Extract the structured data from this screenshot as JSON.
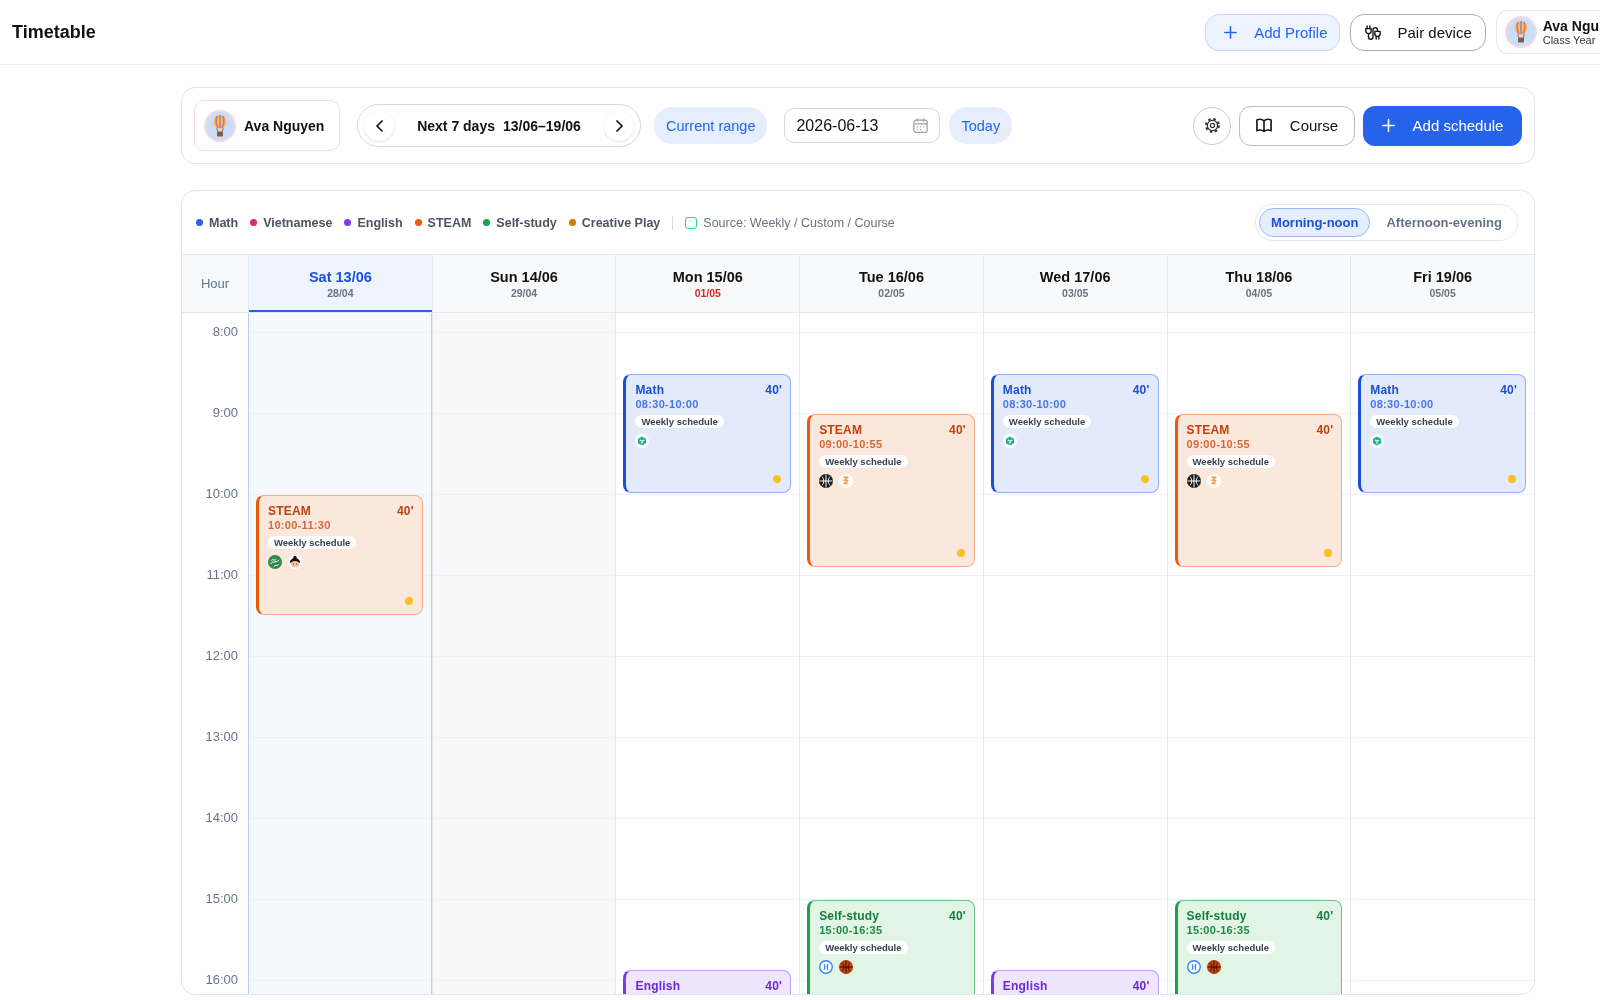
{
  "header": {
    "title": "Timetable",
    "add_profile": "Add Profile",
    "pair_device": "Pair device",
    "profile": {
      "name": "Ava Ngu",
      "subtitle": "Class Year"
    }
  },
  "toolbar": {
    "profile_name": "Ava Nguyen",
    "range_label": "Next 7 days",
    "range_dates": "13/06–19/06",
    "current_range": "Current range",
    "date_value": "2026-06-13",
    "today": "Today",
    "course": "Course",
    "add_schedule": "Add schedule"
  },
  "legend": {
    "items": [
      {
        "label": "Math",
        "color": "#2563eb"
      },
      {
        "label": "Vietnamese",
        "color": "#db2777"
      },
      {
        "label": "English",
        "color": "#7c3aed"
      },
      {
        "label": "STEAM",
        "color": "#ea580c"
      },
      {
        "label": "Self-study",
        "color": "#16a34a"
      },
      {
        "label": "Creative Play",
        "color": "#d97706"
      }
    ],
    "source": "Source: Weekly / Custom / Course"
  },
  "period_toggle": [
    {
      "label": "Morning-noon",
      "selected": true
    },
    {
      "label": "Afternoon-evening",
      "selected": false
    }
  ],
  "grid": {
    "hour_header": "Hour",
    "hours": [
      "8:00",
      "9:00",
      "10:00",
      "11:00",
      "12:00",
      "13:00",
      "14:00",
      "15:00",
      "16:00"
    ],
    "days": [
      {
        "label": "Sat 13/06",
        "lunar": "28/04",
        "selected": true,
        "shaded": false,
        "marked": false,
        "events": [
          {
            "kind": "steam",
            "title": "STEAM",
            "duration": "40'",
            "time": "10:00-11:30",
            "badge": "Weekly schedule",
            "icons": [
              {
                "kind": "swirl"
              },
              {
                "kind": "kid"
              }
            ],
            "color": "#fbbf24"
          }
        ]
      },
      {
        "label": "Sun 14/06",
        "lunar": "29/04",
        "selected": false,
        "shaded": true,
        "marked": false
      },
      {
        "label": "Mon 15/06",
        "lunar": "01/05",
        "selected": false,
        "shaded": false,
        "marked": true,
        "events": [
          {
            "kind": "math",
            "title": "Math",
            "duration": "40'",
            "time": "08:30-10:00",
            "badge": "Weekly schedule",
            "icons": [
              {
                "kind": "cube"
              }
            ],
            "color": "#fbbf24"
          },
          {
            "kind": "english",
            "title": "English",
            "duration": "40'"
          }
        ]
      },
      {
        "label": "Tue 16/06",
        "lunar": "02/05",
        "selected": false,
        "shaded": false,
        "marked": false,
        "events": [
          {
            "kind": "steam",
            "title": "STEAM",
            "duration": "40'",
            "time": "09:00-10:55",
            "badge": "Weekly schedule",
            "icons": [
              {
                "kind": "cross"
              },
              {
                "kind": "squiggle"
              }
            ],
            "color": "#fbbf24"
          },
          {
            "kind": "study",
            "title": "Self-study",
            "duration": "40'",
            "time": "15:00-16:35",
            "badge": "Weekly schedule",
            "icons": [
              {
                "kind": "pause"
              },
              {
                "kind": "ball"
              }
            ]
          }
        ]
      },
      {
        "label": "Wed 17/06",
        "lunar": "03/05",
        "selected": false,
        "shaded": false,
        "marked": false,
        "events": [
          {
            "kind": "math",
            "title": "Math",
            "duration": "40'",
            "time": "08:30-10:00",
            "badge": "Weekly schedule",
            "icons": [
              {
                "kind": "cube"
              }
            ],
            "color": "#fbbf24"
          },
          {
            "kind": "english",
            "title": "English",
            "duration": "40'"
          }
        ]
      },
      {
        "label": "Thu 18/06",
        "lunar": "04/05",
        "selected": false,
        "shaded": false,
        "marked": false,
        "events": [
          {
            "kind": "steam",
            "title": "STEAM",
            "duration": "40'",
            "time": "09:00-10:55",
            "badge": "Weekly schedule",
            "icons": [
              {
                "kind": "cross"
              },
              {
                "kind": "squiggle"
              }
            ],
            "color": "#fbbf24"
          },
          {
            "kind": "study",
            "title": "Self-study",
            "duration": "40'",
            "time": "15:00-16:35",
            "badge": "Weekly schedule",
            "icons": [
              {
                "kind": "pause"
              },
              {
                "kind": "ball"
              }
            ]
          }
        ]
      },
      {
        "label": "Fri 19/06",
        "lunar": "05/05",
        "selected": false,
        "shaded": false,
        "marked": false,
        "events": [
          {
            "kind": "math",
            "title": "Math",
            "duration": "40'",
            "time": "08:30-10:00",
            "badge": "Weekly schedule",
            "icons": [
              {
                "kind": "cube"
              }
            ],
            "color": "#fbbf24"
          }
        ]
      }
    ]
  }
}
